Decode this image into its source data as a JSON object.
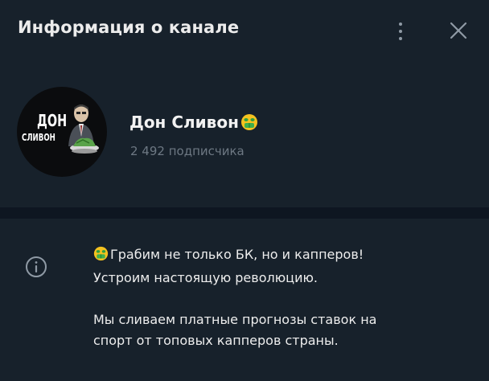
{
  "header": {
    "title": "Информация о канале"
  },
  "profile": {
    "avatar_title": "ДОН",
    "avatar_subtitle": "СЛИВОН",
    "name": "Дон Сливон",
    "subscribers": "2 492 подписчика"
  },
  "info": {
    "line1": "Грабим не только БК, но и капперов!",
    "line2": "Устроим настоящую революцию.",
    "line3": "Мы сливаем платные прогнозы ставок на",
    "line4": "спорт от топовых капперов страны."
  },
  "icons": {
    "menu": "more-vertical-icon",
    "close": "close-icon",
    "emoji": "money-mouth-face-icon",
    "info": "info-icon"
  },
  "colors": {
    "background": "#17212b",
    "divider": "#0e1621",
    "muted_text": "#6d7883",
    "icon": "#8f9aa5"
  }
}
